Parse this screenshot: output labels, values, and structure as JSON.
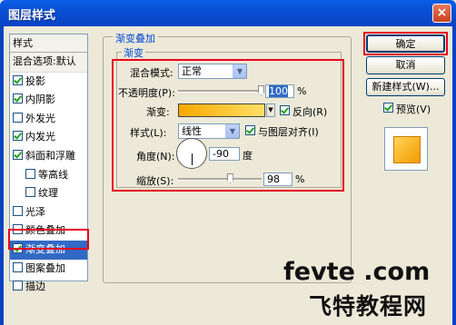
{
  "window": {
    "title": "图层样式",
    "close_glyph": "×"
  },
  "styles_panel": {
    "header": "样式",
    "items": [
      {
        "label": "混合选项:默认",
        "checkbox": null
      },
      {
        "label": "投影",
        "checkbox": true
      },
      {
        "label": "内阴影",
        "checkbox": true
      },
      {
        "label": "外发光",
        "checkbox": false
      },
      {
        "label": "内发光",
        "checkbox": true
      },
      {
        "label": "斜面和浮雕",
        "checkbox": true
      },
      {
        "label": "等高线",
        "checkbox": false
      },
      {
        "label": "纹理",
        "checkbox": false
      },
      {
        "label": "光泽",
        "checkbox": false
      },
      {
        "label": "颜色叠加",
        "checkbox": false
      },
      {
        "label": "渐变叠加",
        "checkbox": true,
        "selected": true
      },
      {
        "label": "图案叠加",
        "checkbox": false
      },
      {
        "label": "描边",
        "checkbox": false
      }
    ]
  },
  "gradient_overlay": {
    "group_title": "渐变叠加",
    "inner_title": "渐变",
    "blend_mode_label": "混合模式:",
    "blend_mode_value": "正常",
    "opacity_label": "不透明度(P):",
    "opacity_value": "100",
    "opacity_percent": 100,
    "opacity_unit": "%",
    "gradient_label": "渐变:",
    "gradient_colors": [
      "#f7a800",
      "#ffe066"
    ],
    "reverse_label": "反向(R)",
    "reverse_checked": true,
    "style_label": "样式(L):",
    "style_value": "线性",
    "align_label": "与图层对齐(I)",
    "align_checked": true,
    "angle_label": "角度(N):",
    "angle_value": "-90",
    "angle_unit": "度",
    "scale_label": "缩放(S):",
    "scale_value": "98",
    "scale_percent": 98,
    "scale_unit": "%"
  },
  "buttons": {
    "ok": "确定",
    "cancel": "取消",
    "new_style": "新建样式(W)...",
    "preview_label": "预览(V)",
    "preview_checked": true
  },
  "watermark": {
    "line1": "fevte .com",
    "line2": "飞特教程网"
  },
  "colors": {
    "highlight": "#e8001c",
    "selection": "#316ac5",
    "title_bar": "#0a4fd3"
  }
}
